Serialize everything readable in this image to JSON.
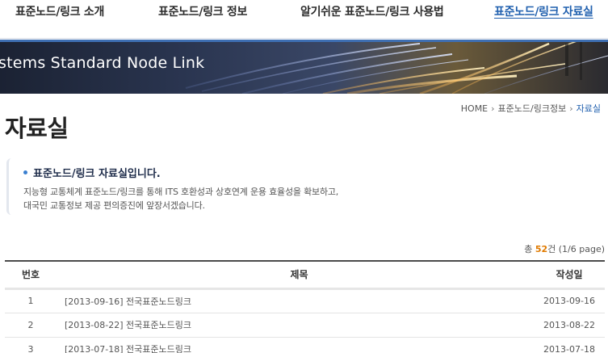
{
  "nav": {
    "items": [
      {
        "label": "표준노드/링크 소개",
        "active": false
      },
      {
        "label": "표준노드/링크 정보",
        "active": false
      },
      {
        "label": "알기쉬운 표준노드/링크 사용법",
        "active": false
      },
      {
        "label": "표준노드/링크 자료실",
        "active": true
      }
    ]
  },
  "banner": {
    "text": "stems Standard Node Link"
  },
  "breadcrumb": {
    "home": "HOME",
    "level1": "표준노드/링크정보",
    "current": "자료실"
  },
  "page": {
    "title": "자료실"
  },
  "intro": {
    "heading": "표준노드/링크 자료실입니다.",
    "line1": "지능형 교통체계 표준노드/링크를 통해 ITS 호환성과 상호연계 운용 효율성을 확보하고,",
    "line2": "대국민 교통정보 제공 편의증진에 앞장서겠습니다."
  },
  "count": {
    "prefix": "총",
    "total": "52",
    "suffix": "건 (1/6 page)"
  },
  "table": {
    "headers": {
      "no": "번호",
      "title": "제목",
      "date": "작성일"
    },
    "rows": [
      {
        "no": "1",
        "title": "[2013-09-16] 전국표준노드링크",
        "date": "2013-09-16"
      },
      {
        "no": "2",
        "title": "[2013-08-22] 전국표준노드링크",
        "date": "2013-08-22"
      },
      {
        "no": "3",
        "title": "[2013-07-18] 전국표준노드링크",
        "date": "2013-07-18"
      }
    ]
  },
  "colors": {
    "accent": "#1f5fae",
    "count_highlight": "#e07a00"
  }
}
